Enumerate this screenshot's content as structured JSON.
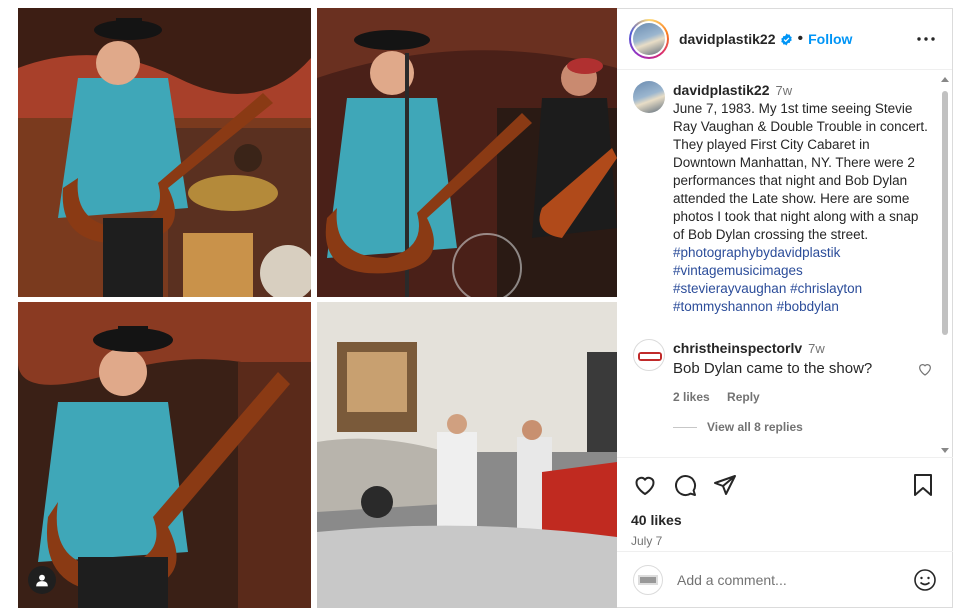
{
  "post": {
    "username": "davidplastik22",
    "follow_label": "Follow",
    "separator": "•",
    "caption_time": "7w",
    "caption_text": "June 7, 1983. My 1st time seeing Stevie Ray Vaughan & Double Trouble in concert. They played First City Cabaret in Downtown Manhattan, NY. There were 2 performances that night and Bob Dylan attended the Late show. Here are some photos I took that night along with a snap of Bob Dylan crossing the street.",
    "hashtags": [
      "#photographybydavidplastik",
      "#vintagemusicimages",
      "#stevierayvaughan",
      "#chrislayton",
      "#tommyshannon",
      "#bobdylan"
    ],
    "likes": "40 likes",
    "date": "July 7"
  },
  "comment": {
    "username": "christheinspectorlv",
    "time": "7w",
    "text": "Bob Dylan came to the show?",
    "likes": "2 likes",
    "reply_label": "Reply",
    "view_replies": "View all 8 replies"
  },
  "add_comment": {
    "placeholder": "Add a comment..."
  },
  "icons": {
    "verified": "verified-badge-icon",
    "more": "more-options-icon",
    "like": "heart-icon",
    "comment": "comment-icon",
    "share": "share-icon",
    "save": "bookmark-icon",
    "tag": "user-tag-icon",
    "emoji": "emoji-icon"
  },
  "colors": {
    "accent": "#0095f6",
    "hashtag": "#2c4d9a",
    "muted": "#737373",
    "text": "#262626"
  }
}
